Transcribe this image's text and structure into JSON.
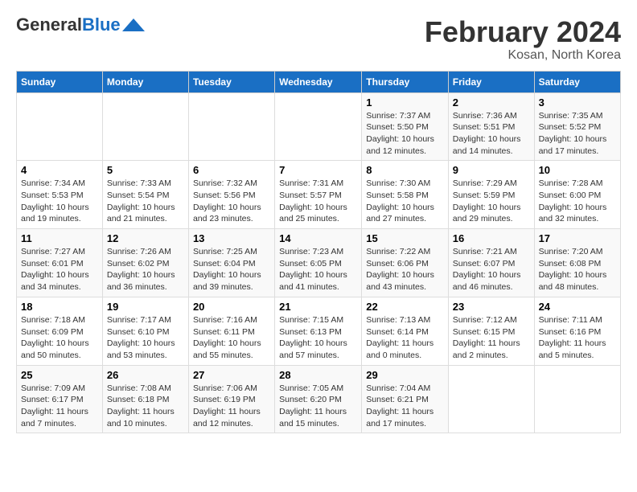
{
  "header": {
    "logo_general": "General",
    "logo_blue": "Blue",
    "month_title": "February 2024",
    "location": "Kosan, North Korea"
  },
  "days_of_week": [
    "Sunday",
    "Monday",
    "Tuesday",
    "Wednesday",
    "Thursday",
    "Friday",
    "Saturday"
  ],
  "weeks": [
    [
      {
        "day": "",
        "info": ""
      },
      {
        "day": "",
        "info": ""
      },
      {
        "day": "",
        "info": ""
      },
      {
        "day": "",
        "info": ""
      },
      {
        "day": "1",
        "info": "Sunrise: 7:37 AM\nSunset: 5:50 PM\nDaylight: 10 hours\nand 12 minutes."
      },
      {
        "day": "2",
        "info": "Sunrise: 7:36 AM\nSunset: 5:51 PM\nDaylight: 10 hours\nand 14 minutes."
      },
      {
        "day": "3",
        "info": "Sunrise: 7:35 AM\nSunset: 5:52 PM\nDaylight: 10 hours\nand 17 minutes."
      }
    ],
    [
      {
        "day": "4",
        "info": "Sunrise: 7:34 AM\nSunset: 5:53 PM\nDaylight: 10 hours\nand 19 minutes."
      },
      {
        "day": "5",
        "info": "Sunrise: 7:33 AM\nSunset: 5:54 PM\nDaylight: 10 hours\nand 21 minutes."
      },
      {
        "day": "6",
        "info": "Sunrise: 7:32 AM\nSunset: 5:56 PM\nDaylight: 10 hours\nand 23 minutes."
      },
      {
        "day": "7",
        "info": "Sunrise: 7:31 AM\nSunset: 5:57 PM\nDaylight: 10 hours\nand 25 minutes."
      },
      {
        "day": "8",
        "info": "Sunrise: 7:30 AM\nSunset: 5:58 PM\nDaylight: 10 hours\nand 27 minutes."
      },
      {
        "day": "9",
        "info": "Sunrise: 7:29 AM\nSunset: 5:59 PM\nDaylight: 10 hours\nand 29 minutes."
      },
      {
        "day": "10",
        "info": "Sunrise: 7:28 AM\nSunset: 6:00 PM\nDaylight: 10 hours\nand 32 minutes."
      }
    ],
    [
      {
        "day": "11",
        "info": "Sunrise: 7:27 AM\nSunset: 6:01 PM\nDaylight: 10 hours\nand 34 minutes."
      },
      {
        "day": "12",
        "info": "Sunrise: 7:26 AM\nSunset: 6:02 PM\nDaylight: 10 hours\nand 36 minutes."
      },
      {
        "day": "13",
        "info": "Sunrise: 7:25 AM\nSunset: 6:04 PM\nDaylight: 10 hours\nand 39 minutes."
      },
      {
        "day": "14",
        "info": "Sunrise: 7:23 AM\nSunset: 6:05 PM\nDaylight: 10 hours\nand 41 minutes."
      },
      {
        "day": "15",
        "info": "Sunrise: 7:22 AM\nSunset: 6:06 PM\nDaylight: 10 hours\nand 43 minutes."
      },
      {
        "day": "16",
        "info": "Sunrise: 7:21 AM\nSunset: 6:07 PM\nDaylight: 10 hours\nand 46 minutes."
      },
      {
        "day": "17",
        "info": "Sunrise: 7:20 AM\nSunset: 6:08 PM\nDaylight: 10 hours\nand 48 minutes."
      }
    ],
    [
      {
        "day": "18",
        "info": "Sunrise: 7:18 AM\nSunset: 6:09 PM\nDaylight: 10 hours\nand 50 minutes."
      },
      {
        "day": "19",
        "info": "Sunrise: 7:17 AM\nSunset: 6:10 PM\nDaylight: 10 hours\nand 53 minutes."
      },
      {
        "day": "20",
        "info": "Sunrise: 7:16 AM\nSunset: 6:11 PM\nDaylight: 10 hours\nand 55 minutes."
      },
      {
        "day": "21",
        "info": "Sunrise: 7:15 AM\nSunset: 6:13 PM\nDaylight: 10 hours\nand 57 minutes."
      },
      {
        "day": "22",
        "info": "Sunrise: 7:13 AM\nSunset: 6:14 PM\nDaylight: 11 hours\nand 0 minutes."
      },
      {
        "day": "23",
        "info": "Sunrise: 7:12 AM\nSunset: 6:15 PM\nDaylight: 11 hours\nand 2 minutes."
      },
      {
        "day": "24",
        "info": "Sunrise: 7:11 AM\nSunset: 6:16 PM\nDaylight: 11 hours\nand 5 minutes."
      }
    ],
    [
      {
        "day": "25",
        "info": "Sunrise: 7:09 AM\nSunset: 6:17 PM\nDaylight: 11 hours\nand 7 minutes."
      },
      {
        "day": "26",
        "info": "Sunrise: 7:08 AM\nSunset: 6:18 PM\nDaylight: 11 hours\nand 10 minutes."
      },
      {
        "day": "27",
        "info": "Sunrise: 7:06 AM\nSunset: 6:19 PM\nDaylight: 11 hours\nand 12 minutes."
      },
      {
        "day": "28",
        "info": "Sunrise: 7:05 AM\nSunset: 6:20 PM\nDaylight: 11 hours\nand 15 minutes."
      },
      {
        "day": "29",
        "info": "Sunrise: 7:04 AM\nSunset: 6:21 PM\nDaylight: 11 hours\nand 17 minutes."
      },
      {
        "day": "",
        "info": ""
      },
      {
        "day": "",
        "info": ""
      }
    ]
  ]
}
